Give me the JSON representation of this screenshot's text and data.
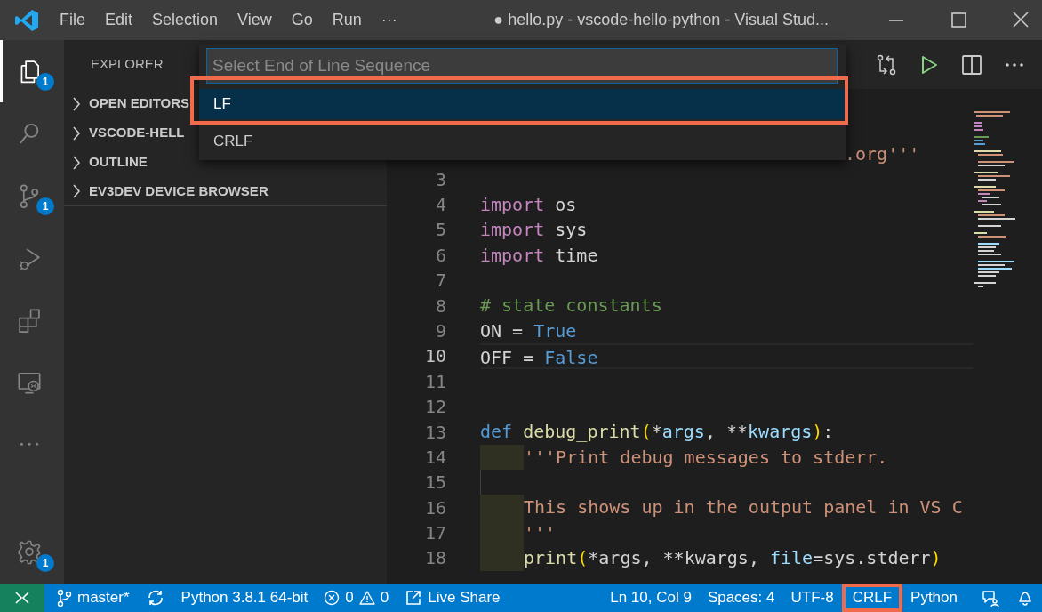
{
  "title_bar": {
    "menus": [
      "File",
      "Edit",
      "Selection",
      "View",
      "Go",
      "Run",
      "···"
    ],
    "title": "● hello.py - vscode-hello-python - Visual Stud..."
  },
  "activity_bar": [
    {
      "kind": "files",
      "selected": true,
      "badge": "1"
    },
    {
      "kind": "search",
      "selected": false
    },
    {
      "kind": "source-control",
      "selected": false,
      "badge": "1"
    },
    {
      "kind": "run",
      "selected": false
    },
    {
      "kind": "extensions",
      "selected": false
    },
    {
      "kind": "remote",
      "selected": false
    },
    {
      "kind": "more",
      "selected": false
    },
    {
      "kind": "settings",
      "selected": false,
      "badge": "1"
    }
  ],
  "sidebar": {
    "title": "EXPLORER",
    "sections": [
      {
        "label": "OPEN EDITORS",
        "expanded": false
      },
      {
        "label": "VSCODE-HELL",
        "expanded": false
      },
      {
        "label": "OUTLINE",
        "expanded": false
      },
      {
        "label": "EV3DEV DEVICE BROWSER",
        "expanded": false
      }
    ]
  },
  "quick_pick": {
    "placeholder": "Select End of Line Sequence",
    "items": [
      {
        "label": "LF",
        "selected": true,
        "highlighted": true
      },
      {
        "label": "CRLF",
        "selected": false,
        "highlighted": false
      }
    ]
  },
  "editor": {
    "lines": [
      {
        "covered": true,
        "tokens": [
          {
            "kind": "string",
            "text": ".org'''"
          }
        ]
      },
      {
        "number": "3"
      },
      {
        "number": "4",
        "tokens": [
          {
            "kind": "keyword",
            "text": "import"
          },
          {
            "kind": "plain",
            "text": " os"
          }
        ]
      },
      {
        "number": "5",
        "tokens": [
          {
            "kind": "keyword",
            "text": "import"
          },
          {
            "kind": "plain",
            "text": " sys"
          }
        ]
      },
      {
        "number": "6",
        "tokens": [
          {
            "kind": "keyword",
            "text": "import"
          },
          {
            "kind": "plain",
            "text": " time"
          }
        ]
      },
      {
        "number": "7"
      },
      {
        "number": "8",
        "tokens": [
          {
            "kind": "comment",
            "text": "# state constants"
          }
        ]
      },
      {
        "number": "9",
        "tokens": [
          {
            "kind": "plain",
            "text": "ON = "
          },
          {
            "kind": "constant",
            "text": "True"
          }
        ]
      },
      {
        "number": "10",
        "current": true,
        "tokens": [
          {
            "kind": "plain",
            "text": "OFF = "
          },
          {
            "kind": "constant",
            "text": "False"
          }
        ]
      },
      {
        "number": "11"
      },
      {
        "number": "12"
      },
      {
        "number": "13",
        "tokens": [
          {
            "kind": "constant",
            "text": "def"
          },
          {
            "kind": "function",
            "text": " debug_print"
          },
          {
            "kind": "paren",
            "text": "("
          },
          {
            "kind": "plain",
            "text": "*"
          },
          {
            "kind": "param",
            "text": "args"
          },
          {
            "kind": "plain",
            "text": ", **"
          },
          {
            "kind": "param",
            "text": "kwargs"
          },
          {
            "kind": "paren",
            "text": ")"
          },
          {
            "kind": "plain",
            "text": ":"
          }
        ]
      },
      {
        "number": "14",
        "indented": true,
        "marked": true,
        "tokens": [
          {
            "kind": "string",
            "text": "'''Print debug messages to stderr."
          }
        ]
      },
      {
        "number": "15",
        "indented": true,
        "marked": false
      },
      {
        "number": "16",
        "indented": true,
        "marked": true,
        "tokens": [
          {
            "kind": "string",
            "text": "This shows up in the output panel in VS C"
          }
        ]
      },
      {
        "number": "17",
        "indented": true,
        "marked": true,
        "tokens": [
          {
            "kind": "string",
            "text": "'''"
          }
        ]
      },
      {
        "number": "18",
        "indented": true,
        "marked": true,
        "tokens": [
          {
            "kind": "function",
            "text": "print"
          },
          {
            "kind": "paren",
            "text": "("
          },
          {
            "kind": "plain",
            "text": "*args, **kwargs, "
          },
          {
            "kind": "param",
            "text": "file"
          },
          {
            "kind": "plain",
            "text": "=sys.stderr"
          },
          {
            "kind": "paren",
            "text": ")"
          }
        ]
      }
    ]
  },
  "status_bar": [
    {
      "kind": "remote"
    },
    {
      "kind": "branch",
      "text": "master*"
    },
    {
      "kind": "sync"
    },
    {
      "kind": "text",
      "text": "Python 3.8.1 64-bit"
    },
    {
      "kind": "problems",
      "errors": "0",
      "warnings": "0"
    },
    {
      "kind": "live-share",
      "text": "Live Share"
    },
    {
      "kind": "text",
      "text": "Ln 10, Col 9",
      "push": true
    },
    {
      "kind": "text",
      "text": "Spaces: 4"
    },
    {
      "kind": "text",
      "text": "UTF-8"
    },
    {
      "kind": "text",
      "text": "CRLF",
      "highlighted": true
    },
    {
      "kind": "text",
      "text": "Python"
    },
    {
      "kind": "feedback"
    },
    {
      "kind": "bell"
    }
  ]
}
